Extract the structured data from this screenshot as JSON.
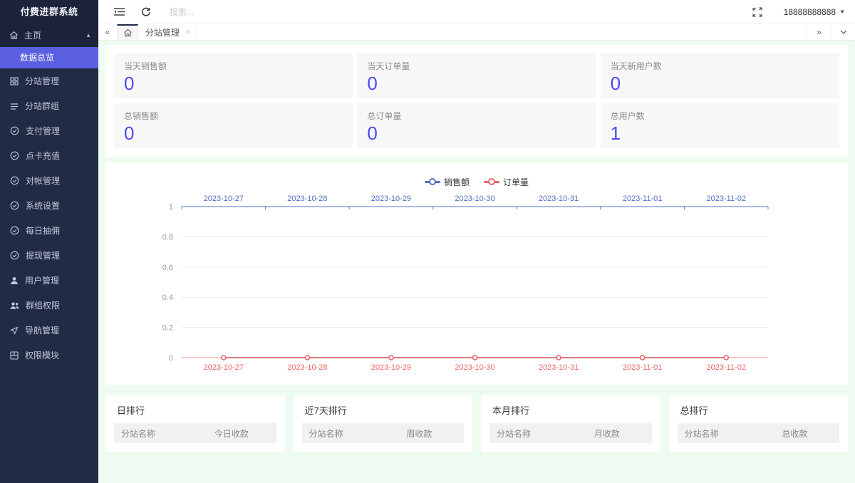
{
  "app": {
    "title": "付费进群系统"
  },
  "header": {
    "search_placeholder": "搜索...",
    "user_phone": "18888888888"
  },
  "tabbar": {
    "open_tab": "分站管理",
    "close_label": "×"
  },
  "sidebar": {
    "home": {
      "label": "主页"
    },
    "active_item": {
      "label": "数据总览"
    },
    "items": [
      {
        "label": "分站管理",
        "icon": "grid-icon"
      },
      {
        "label": "分站群组",
        "icon": "list-icon"
      },
      {
        "label": "支付管理",
        "icon": "circle-check-icon"
      },
      {
        "label": "点卡充值",
        "icon": "circle-check-icon"
      },
      {
        "label": "对帐管理",
        "icon": "circle-check-icon"
      },
      {
        "label": "系统设置",
        "icon": "circle-check-icon"
      },
      {
        "label": "每日抽佣",
        "icon": "circle-check-icon"
      },
      {
        "label": "提现管理",
        "icon": "circle-check-icon"
      },
      {
        "label": "用户管理",
        "icon": "user-icon"
      },
      {
        "label": "群组权限",
        "icon": "users-icon"
      },
      {
        "label": "导航管理",
        "icon": "nav-icon"
      },
      {
        "label": "权限模块",
        "icon": "module-icon"
      }
    ]
  },
  "stats": {
    "cards": [
      {
        "label": "当天销售额",
        "value": "0"
      },
      {
        "label": "当天订单量",
        "value": "0"
      },
      {
        "label": "当天新用户数",
        "value": "0"
      },
      {
        "label": "总销售额",
        "value": "0"
      },
      {
        "label": "总订单量",
        "value": "0"
      },
      {
        "label": "总用户数",
        "value": "1"
      }
    ],
    "value_color": "#4c4bf0"
  },
  "chart_data": {
    "type": "line",
    "x": [
      "2023-10-27",
      "2023-10-28",
      "2023-10-29",
      "2023-10-30",
      "2023-10-31",
      "2023-11-01",
      "2023-11-02"
    ],
    "series": [
      {
        "name": "销售额",
        "color": "#5470c6",
        "axis": "top",
        "values": [
          0,
          0,
          0,
          0,
          0,
          0,
          0
        ]
      },
      {
        "name": "订单量",
        "color": "#ee6666",
        "axis": "bottom",
        "values": [
          0,
          0,
          0,
          0,
          0,
          0,
          0
        ]
      }
    ],
    "ylim": [
      0,
      1
    ],
    "yticks": [
      0,
      0.2,
      0.4,
      0.6,
      0.8,
      1
    ],
    "grid": true,
    "legend_position": "top-center",
    "top_axis_color": "#5470c6",
    "bottom_axis_color": "#f3b3b3",
    "gridline_color": "#ececec",
    "ytick_color": "#999999"
  },
  "rankings": [
    {
      "title": "日排行",
      "columns": [
        "分站名称",
        "今日收款"
      ]
    },
    {
      "title": "近7天排行",
      "columns": [
        "分站名称",
        "周收款"
      ]
    },
    {
      "title": "本月排行",
      "columns": [
        "分站名称",
        "月收款"
      ]
    },
    {
      "title": "总排行",
      "columns": [
        "分站名称",
        "总收款"
      ]
    }
  ]
}
